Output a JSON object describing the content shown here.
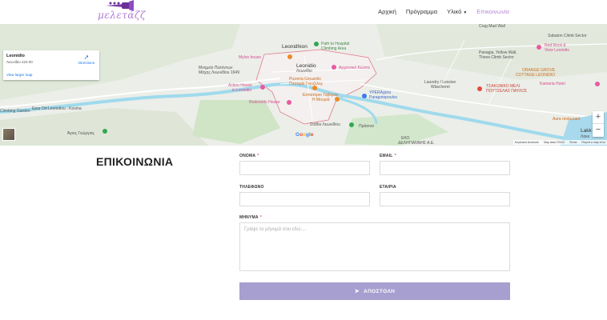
{
  "header": {
    "logo_text": "μελετάζζ",
    "nav": [
      {
        "label": "Αρχική"
      },
      {
        "label": "Πρόγραμμα"
      },
      {
        "label": "Υλικό"
      },
      {
        "label": "Επικοινωνία"
      }
    ]
  },
  "map": {
    "card": {
      "place": "Leonidio",
      "address": "Λεωνίδιο 223 00",
      "directions": "Directions",
      "larger_map": "View larger map"
    },
    "labels": {
      "leonidhion": "Leonidhion",
      "leonidio": "Leonidio",
      "leonidio_gr": "Λεωνίδιο",
      "path_hospital": "Path to Hospital",
      "climbing_area": "Climbing Area",
      "mylos_house": "Mylos house",
      "monument": "Μνημείο Πεσόντων",
      "monument2": "Μάχης Λεωνιδίου 1949",
      "arxontiko": "Αρχοντικό Κώστα",
      "pizzeria": "Pizzeria Giouzelis",
      "pizzeria_gr": "Πιτσαρία Γιουζέλης",
      "action_house": "Action House",
      "in_leonidio": "in Leonidio",
      "rodomelo": "Rodomelo House",
      "estiatorio": "Εστιατόριο Ταβέρνα",
      "mouria": "Η Μουριά",
      "yperagora": "YPERAgora",
      "paragotopoulos": "Paragotopoulos",
      "stadio": "Στάδιο Λεωνιδίου",
      "laundry": "Laundry / Lessive",
      "waschere": "Wäscherei",
      "tsakoniko": "ΤΣΑΚΩΝΙΚΟ ΜΕΛΙ",
      "poutselas": "ΠΟΥΤΣΕΛΑΣ ΠΑΥΛΟΣ",
      "panagia": "Panagia, Yellow Wall,",
      "theos": "Theos Climb Sector",
      "red_rock": "Red Rock &",
      "view_leonidio": "View Leonidio",
      "orange_grove": "ORANGE GROVE",
      "cottage": "COTTAGE LEONIDIO",
      "kamaria": "Kamaria Hotel",
      "sabaton": "Sabaton Climb Sector",
      "crag_mad": "Crag Mad Wall",
      "aura": "Aura restaurant",
      "agios": "Άγιος Γεώργιος",
      "eko": "ΕΚΟ",
      "delegiannis": "ΔΕΛΗΓΙΑΝΝΗΣ Α.Ε.",
      "lakk": "Lakk",
      "lakk_gr": "Λακκ",
      "epar_od": "Epar Od Leonidiou - Kosma",
      "climbing_garden": "Climbing Garden",
      "prasina": "Πράσινα"
    },
    "google": "Google",
    "attribution": [
      "Keyboard shortcuts",
      "Map data ©2024",
      "Terms",
      "Report a map error"
    ]
  },
  "contact": {
    "title": "ΕΠΙΚΟΙΝΩΝΙΑ",
    "name_label": "ΟΝΟΜΑ",
    "email_label": "EMAIL",
    "phone_label": "ΤΗΛΕΦΩΝΟ",
    "company_label": "ΕΤΑΙΡΙΑ",
    "message_label": "ΜΗΝΥΜΑ",
    "required_mark": "*",
    "message_placeholder": "Γράψε το μήνυμά σου εδώ....",
    "submit_label": "ΑΠΟΣΤΟΛΗ"
  },
  "colors": {
    "accent": "#b58ad9",
    "button": "#a79fd0",
    "river": "#8fd3e8",
    "town_border": "#e07a8a"
  }
}
